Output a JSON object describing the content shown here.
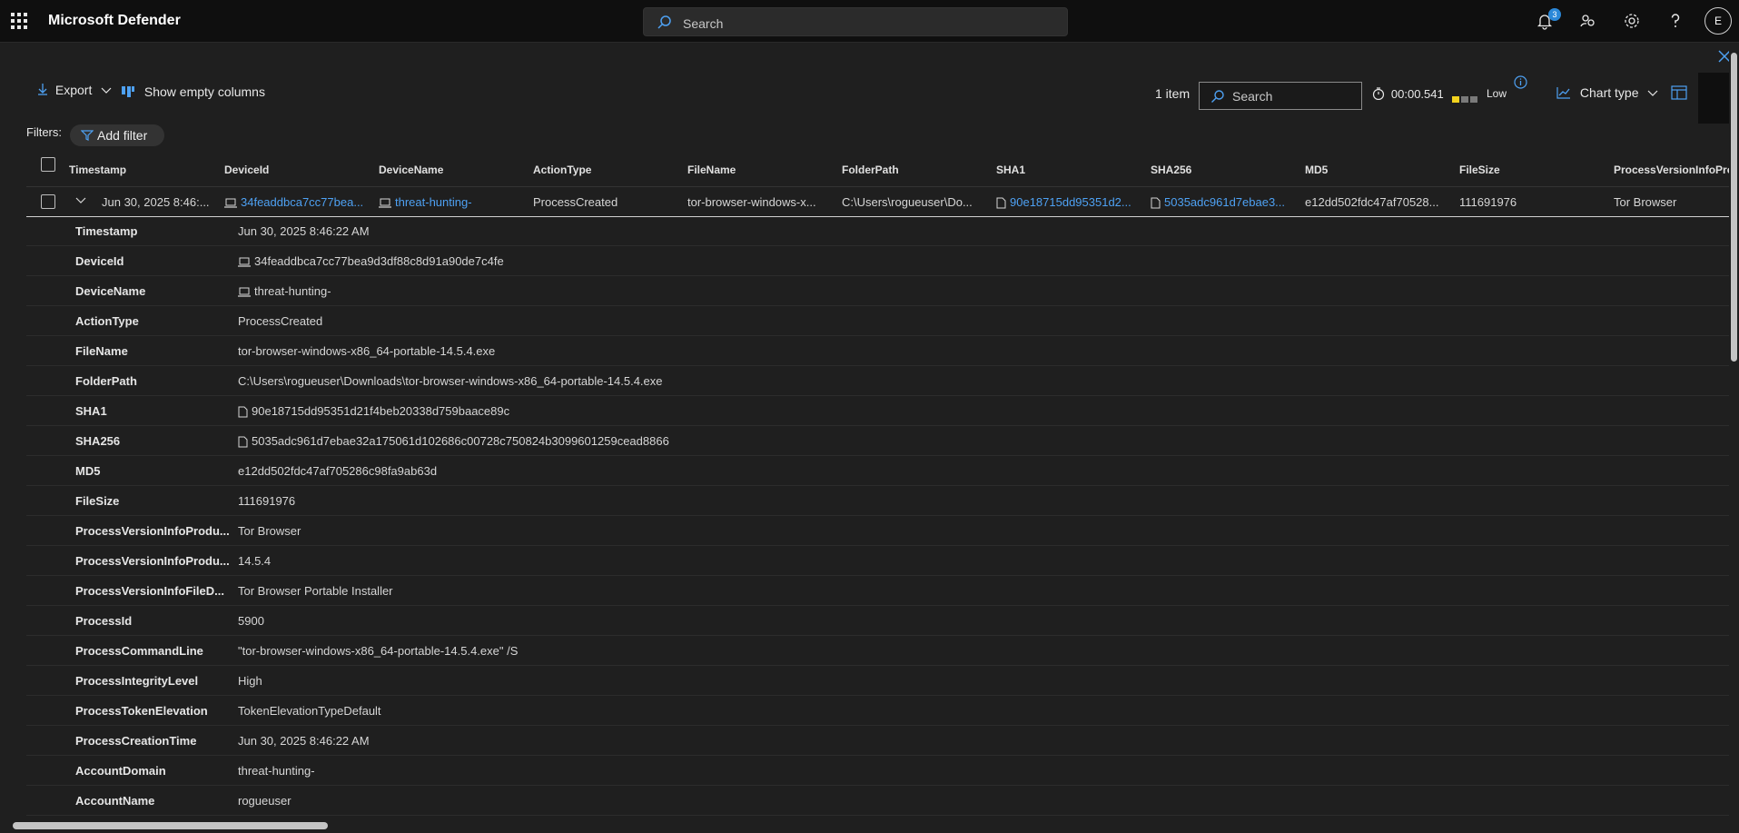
{
  "app": {
    "title": "Microsoft Defender"
  },
  "top_search": {
    "placeholder": "Search"
  },
  "notifications": {
    "count": "3"
  },
  "user": {
    "initial": "E"
  },
  "toolbar": {
    "export_label": "Export",
    "show_empty_columns_label": "Show empty columns",
    "item_count": "1 item",
    "search_placeholder": "Search",
    "query_time": "00:00.541",
    "resource_usage_label": "Low",
    "chart_type_label": "Chart type"
  },
  "filters": {
    "label": "Filters:",
    "add_filter_label": "Add filter"
  },
  "columns": [
    "Timestamp",
    "DeviceId",
    "DeviceName",
    "ActionType",
    "FileName",
    "FolderPath",
    "SHA1",
    "SHA256",
    "MD5",
    "FileSize",
    "ProcessVersionInfoProd"
  ],
  "row": {
    "timestamp": "Jun 30, 2025 8:46:...",
    "device_id": "34feaddbca7cc77bea...",
    "device_name": "threat-hunting-",
    "action_type": "ProcessCreated",
    "file_name": "tor-browser-windows-x...",
    "folder_path": "C:\\Users\\rogueuser\\Do...",
    "sha1": "90e18715dd95351d2...",
    "sha256": "5035adc961d7ebae3...",
    "md5": "e12dd502fdc47af70528...",
    "file_size": "111691976",
    "product": "Tor Browser"
  },
  "details": [
    {
      "key": "Timestamp",
      "value": "Jun 30, 2025 8:46:22 AM",
      "link": false,
      "icon": ""
    },
    {
      "key": "DeviceId",
      "value": "34feaddbca7cc77bea9d3df88c8d91a90de7c4fe",
      "link": true,
      "icon": "laptop-icon"
    },
    {
      "key": "DeviceName",
      "value": "threat-hunting-",
      "link": true,
      "icon": "laptop-icon"
    },
    {
      "key": "ActionType",
      "value": "ProcessCreated",
      "link": false,
      "icon": ""
    },
    {
      "key": "FileName",
      "value": "tor-browser-windows-x86_64-portable-14.5.4.exe",
      "link": false,
      "icon": ""
    },
    {
      "key": "FolderPath",
      "value": "C:\\Users\\rogueuser\\Downloads\\tor-browser-windows-x86_64-portable-14.5.4.exe",
      "link": false,
      "icon": ""
    },
    {
      "key": "SHA1",
      "value": "90e18715dd95351d21f4beb20338d759baace89c",
      "link": true,
      "icon": "file-icon"
    },
    {
      "key": "SHA256",
      "value": "5035adc961d7ebae32a175061d102686c00728c750824b3099601259cead8866",
      "link": true,
      "icon": "file-icon"
    },
    {
      "key": "MD5",
      "value": "e12dd502fdc47af705286c98fa9ab63d",
      "link": false,
      "icon": ""
    },
    {
      "key": "FileSize",
      "value": "111691976",
      "link": false,
      "icon": ""
    },
    {
      "key": "ProcessVersionInfoProdu...",
      "value": "Tor Browser",
      "link": false,
      "icon": ""
    },
    {
      "key": "ProcessVersionInfoProdu...",
      "value": "14.5.4",
      "link": false,
      "icon": ""
    },
    {
      "key": "ProcessVersionInfoFileD...",
      "value": "Tor Browser Portable Installer",
      "link": false,
      "icon": ""
    },
    {
      "key": "ProcessId",
      "value": "5900",
      "link": false,
      "icon": ""
    },
    {
      "key": "ProcessCommandLine",
      "value": "\"tor-browser-windows-x86_64-portable-14.5.4.exe\" /S",
      "link": false,
      "icon": ""
    },
    {
      "key": "ProcessIntegrityLevel",
      "value": "High",
      "link": false,
      "icon": ""
    },
    {
      "key": "ProcessTokenElevation",
      "value": "TokenElevationTypeDefault",
      "link": false,
      "icon": ""
    },
    {
      "key": "ProcessCreationTime",
      "value": "Jun 30, 2025 8:46:22 AM",
      "link": false,
      "icon": ""
    },
    {
      "key": "AccountDomain",
      "value": "threat-hunting-",
      "link": false,
      "icon": ""
    },
    {
      "key": "AccountName",
      "value": "rogueuser",
      "link": false,
      "icon": ""
    }
  ],
  "colors": {
    "accent": "#4ea1f3",
    "background": "#1f1f1f",
    "topbar": "#0f0f0f"
  }
}
